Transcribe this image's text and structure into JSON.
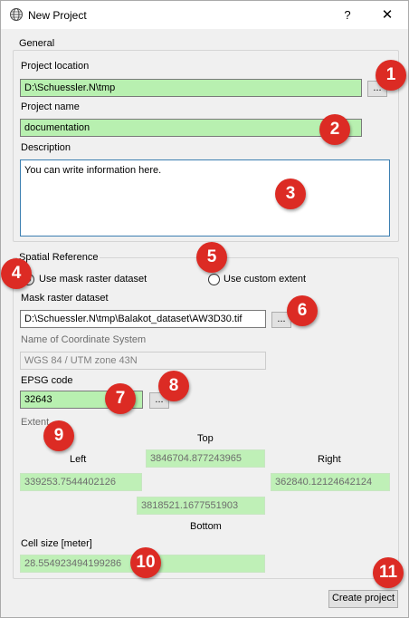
{
  "window": {
    "title": "New Project",
    "help": "?",
    "close": "✕"
  },
  "general": {
    "title": "General",
    "project_location_label": "Project location",
    "project_location_value": "D:\\Schuessler.N\\tmp",
    "browse_label": "...",
    "project_name_label": "Project name",
    "project_name_value": "documentation",
    "description_label": "Description",
    "description_value": "You can write information here."
  },
  "spatial": {
    "title": "Spatial Reference",
    "radio_mask": "Use mask raster dataset",
    "radio_custom": "Use custom extent",
    "selected": "mask",
    "mask_label": "Mask raster dataset",
    "mask_value": "D:\\Schuessler.N\\tmp\\Balakot_dataset\\AW3D30.tif",
    "browse_label": "...",
    "crs_label": "Name of Coordinate System",
    "crs_value": "WGS 84 / UTM zone 43N",
    "epsg_label": "EPSG code",
    "epsg_value": "32643",
    "extent_label": "Extent",
    "top_label": "Top",
    "top_value": "3846704.877243965",
    "left_label": "Left",
    "left_value": "339253.7544402126",
    "right_label": "Right",
    "right_value": "362840.12124642124",
    "bottom_value": "3818521.1677551903",
    "bottom_label": "Bottom",
    "cellsize_label": "Cell size [meter]",
    "cellsize_value": "28.554923494199286"
  },
  "create_label": "Create project",
  "badges": [
    "1",
    "2",
    "3",
    "4",
    "5",
    "6",
    "7",
    "8",
    "9",
    "10",
    "11"
  ],
  "colors": {
    "badge": "#dc2b24",
    "field_green": "#b8f0b0"
  }
}
